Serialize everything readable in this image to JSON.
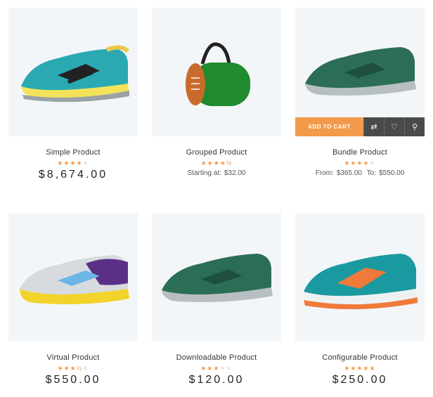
{
  "products": [
    {
      "name": "Simple Product",
      "rating": 4,
      "price": "$8,674.00"
    },
    {
      "name": "Grouped Product",
      "rating": 4.5,
      "price_label": "Starting at:",
      "price_value": "$32.00"
    },
    {
      "name": "Bundle Product",
      "rating": 4,
      "from_label": "From:",
      "from_value": "$365.00",
      "to_label": "To:",
      "to_value": "$550.00"
    },
    {
      "name": "Virtual Product",
      "rating": 3.5,
      "price": "$550.00"
    },
    {
      "name": "Downloadable Product",
      "rating": 3,
      "price": "$120.00"
    },
    {
      "name": "Configurable Product",
      "rating": 5,
      "price": "$250.00"
    }
  ],
  "hover_actions": {
    "add_to_cart": "ADD TO CART",
    "compare_icon": "compare-icon",
    "wishlist_icon": "heart-icon",
    "quickview_icon": "search-icon"
  },
  "colors": {
    "accent": "#f39a4a",
    "action_dark": "#4a4a4a",
    "image_bg": "#f3f6f9"
  }
}
